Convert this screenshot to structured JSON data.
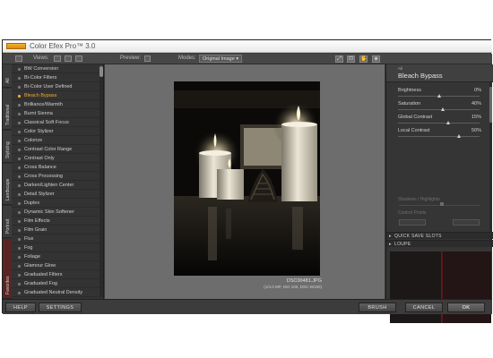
{
  "window": {
    "title": "Color Efex Pro™ 3.0"
  },
  "toolbar": {
    "views_label": "Views:",
    "preview_label": "Preview:",
    "modes_label": "Modes:",
    "modes_value": "Original Image"
  },
  "tabs": [
    {
      "label": "All"
    },
    {
      "label": "Traditional"
    },
    {
      "label": "Stylizing"
    },
    {
      "label": "Landscape"
    },
    {
      "label": "Portrait"
    },
    {
      "label": "Favorites"
    }
  ],
  "filters": [
    "BW Conversion",
    "Bi-Color Filters",
    "Bi-Color User Defined",
    "Bleach Bypass",
    "Brilliance/Warmth",
    "Burnt Sienna",
    "Classical Soft Focus",
    "Color Stylizer",
    "Colorize",
    "Contrast Color Range",
    "Contrast Only",
    "Cross Balance",
    "Cross Processing",
    "Darken/Lighten Center",
    "Detail Stylizer",
    "Duplex",
    "Dynamic Skin Softener",
    "Film Effects",
    "Film Grain",
    "Flux",
    "Fog",
    "Foliage",
    "Glamour Glow",
    "Graduated Filters",
    "Graduated Fog",
    "Graduated Neutral Density"
  ],
  "selected_filter_index": 3,
  "image": {
    "filename": "DSC00481.JPG",
    "info": "(1/4.0 MP, ISO 100, DSC-W150)"
  },
  "panel": {
    "category": "All",
    "filter_name": "Bleach Bypass",
    "sliders": [
      {
        "label": "Brightness",
        "value": "0%",
        "level": 0.5
      },
      {
        "label": "Saturation",
        "value": "40%",
        "level": 0.55
      },
      {
        "label": "Global Contrast",
        "value": "15%",
        "level": 0.62
      },
      {
        "label": "Local Contrast",
        "value": "50%",
        "level": 0.75
      }
    ],
    "shadows_label": "Shadows / Highlights",
    "control_points_label": "Control Points",
    "sections": [
      "QUICK SAVE SLOTS",
      "LOUPE"
    ]
  },
  "buttons": {
    "help": "HELP",
    "settings": "SETTINGS",
    "brush": "BRUSH",
    "cancel": "CANCEL",
    "ok": "OK"
  },
  "colors": {
    "accent": "#f2a935",
    "panel_bg": "#353535",
    "preview_bg": "#6d6d6d"
  }
}
